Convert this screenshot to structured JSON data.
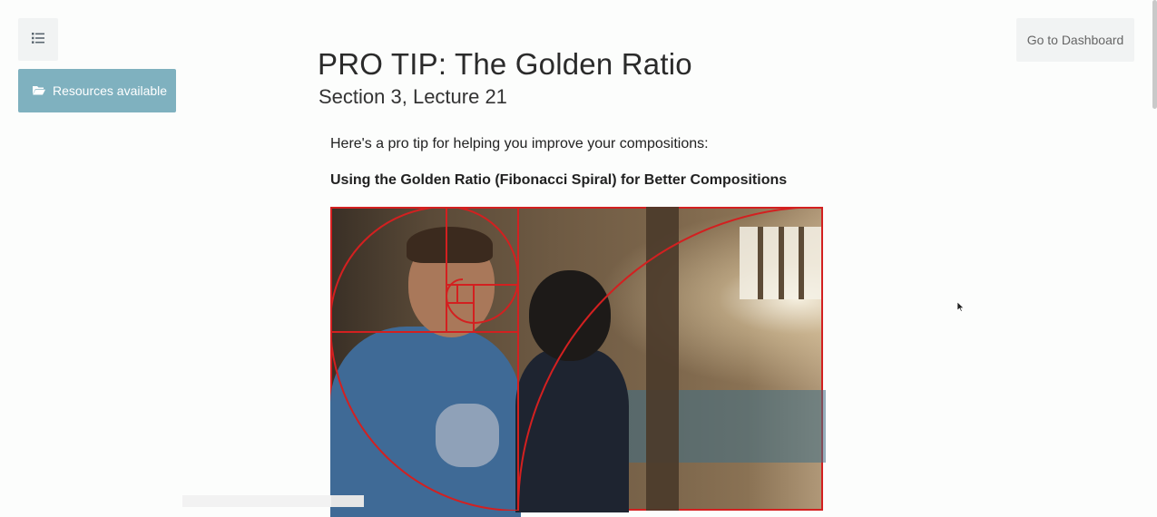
{
  "nav": {
    "menu_icon": "list-icon",
    "resources_label": "Resources available",
    "resources_icon": "folder-open-icon",
    "dashboard_label": "Go to Dashboard"
  },
  "lecture": {
    "title": "PRO TIP: The Golden Ratio",
    "subtitle": "Section 3, Lecture 21",
    "intro": "Here's a pro tip for helping you improve your compositions:",
    "heading": "Using the Golden Ratio (Fibonacci Spiral) for Better Compositions"
  },
  "colors": {
    "resources_bg": "#7fb1bf",
    "overlay_red": "#d32020",
    "button_gray": "#f1f3f3"
  }
}
